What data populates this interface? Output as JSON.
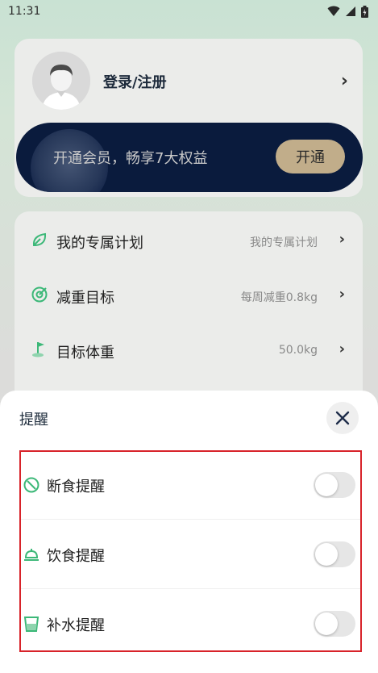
{
  "status_bar": {
    "time": "11:31"
  },
  "profile": {
    "login_label": "登录/注册"
  },
  "vip": {
    "text": "开通会员，畅享7大权益",
    "button_label": "开通"
  },
  "menu": {
    "items": [
      {
        "label": "我的专属计划",
        "value": "我的专属计划",
        "icon": "leaf-icon"
      },
      {
        "label": "减重目标",
        "value": "每周减重0.8kg",
        "icon": "target-icon"
      },
      {
        "label": "目标体重",
        "value": "50.0kg",
        "icon": "flag-icon"
      }
    ]
  },
  "sheet": {
    "title": "提醒",
    "reminders": [
      {
        "label": "断食提醒",
        "icon": "fasting-icon",
        "enabled": false
      },
      {
        "label": "饮食提醒",
        "icon": "meal-cloche-icon",
        "enabled": false
      },
      {
        "label": "补水提醒",
        "icon": "water-cup-icon",
        "enabled": false
      }
    ]
  },
  "colors": {
    "accent_green": "#3cb878",
    "vip_navy": "#0a1b3d",
    "vip_gold": "#c1ad8a",
    "highlight_red": "#d8232a"
  }
}
